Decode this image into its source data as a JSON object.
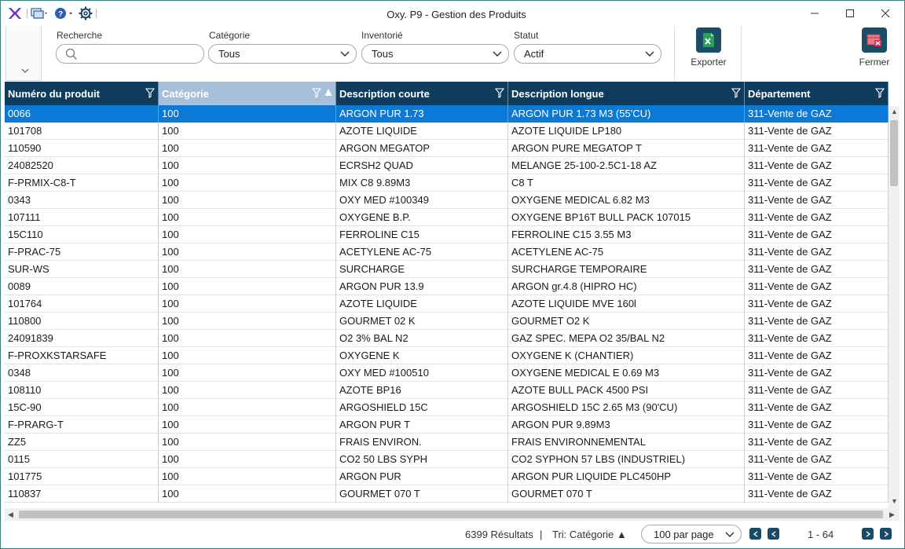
{
  "window": {
    "title": "Oxy. P9 - Gestion des Produits",
    "icons": [
      "app-logo-icon",
      "windows-icon",
      "help-icon",
      "settings-icon",
      "minimize-icon",
      "maximize-icon",
      "close-icon"
    ]
  },
  "filters": {
    "search": {
      "label": "Recherche",
      "value": "",
      "placeholder": ""
    },
    "category": {
      "label": "Catégorie",
      "value": "Tous"
    },
    "inventory": {
      "label": "Inventorié",
      "value": "Tous"
    },
    "status": {
      "label": "Statut",
      "value": "Actif"
    }
  },
  "actions": {
    "export_label": "Exporter",
    "close_label": "Fermer",
    "export_color": "#1a4d66",
    "close_color": "#1a4d66"
  },
  "grid": {
    "columns": [
      {
        "label": "Numéro du produit"
      },
      {
        "label": "Catégorie",
        "sorted": "asc"
      },
      {
        "label": "Description courte"
      },
      {
        "label": "Description longue"
      },
      {
        "label": "Département"
      }
    ],
    "selected_row": 0,
    "rows": [
      [
        "0066",
        "100",
        "ARGON PUR 1.73",
        "ARGON PUR 1.73 M3 (55'CU)",
        "311-Vente de GAZ"
      ],
      [
        "101708",
        "100",
        "AZOTE LIQUIDE",
        "AZOTE LIQUIDE  LP180",
        "311-Vente de GAZ"
      ],
      [
        "110590",
        "100",
        "ARGON MEGATOP",
        "ARGON PURE MEGATOP  T",
        "311-Vente de GAZ"
      ],
      [
        "24082520",
        "100",
        "ECRSH2 QUAD",
        "MELANGE 25-100-2.5C1-18 AZ",
        "311-Vente de GAZ"
      ],
      [
        "F-PRMIX-C8-T",
        "100",
        "MIX C8  9.89M3",
        "C8 T",
        "311-Vente de GAZ"
      ],
      [
        "0343",
        "100",
        "OXY MED #100349",
        "OXYGENE MEDICAL 6.82 M3",
        "311-Vente de GAZ"
      ],
      [
        "107111",
        "100",
        "OXYGENE B.P.",
        "OXYGENE BP16T  BULL PACK 107015",
        "311-Vente de GAZ"
      ],
      [
        "15C110",
        "100",
        "FERROLINE C15",
        "FERROLINE C15  3.55 M3",
        "311-Vente de GAZ"
      ],
      [
        "F-PRAC-75",
        "100",
        "ACETYLENE AC-75",
        "ACETYLENE AC-75",
        "311-Vente de GAZ"
      ],
      [
        "SUR-WS",
        "100",
        "SURCHARGE",
        "SURCHARGE TEMPORAIRE",
        "311-Vente de GAZ"
      ],
      [
        "0089",
        "100",
        "ARGON PUR 13.9",
        "ARGON gr.4.8 (HIPRO HC)",
        "311-Vente de GAZ"
      ],
      [
        "101764",
        "100",
        "AZOTE LIQUIDE",
        "AZOTE LIQUIDE MVE 160l",
        "311-Vente de GAZ"
      ],
      [
        "110800",
        "100",
        "GOURMET  02  K",
        "GOURMET O2  K",
        "311-Vente de GAZ"
      ],
      [
        "24091839",
        "100",
        "O2 3% BAL N2",
        "GAZ SPEC. MEPA O2 35/BAL N2",
        "311-Vente de GAZ"
      ],
      [
        "F-PROXKSTARSAFE",
        "100",
        "OXYGENE K",
        "OXYGENE K (CHANTIER)",
        "311-Vente de GAZ"
      ],
      [
        "0348",
        "100",
        "OXY MED #100510",
        "OXYGENE MEDICAL  E  0.69 M3",
        "311-Vente de GAZ"
      ],
      [
        "108110",
        "100",
        "AZOTE  BP16",
        "AZOTE  BULL PACK 4500 PSI",
        "311-Vente de GAZ"
      ],
      [
        "15C-90",
        "100",
        "ARGOSHIELD 15C",
        "ARGOSHIELD 15C 2.65 M3 (90'CU)",
        "311-Vente de GAZ"
      ],
      [
        "F-PRARG-T",
        "100",
        "ARGON PUR T",
        "ARGON PUR 9.89M3",
        "311-Vente de GAZ"
      ],
      [
        "ZZ5",
        "100",
        "FRAIS ENVIRON.",
        "FRAIS ENVIRONNEMENTAL",
        "311-Vente de GAZ"
      ],
      [
        "0115",
        "100",
        "CO2 50 LBS SYPH",
        "CO2 SYPHON 57 LBS (INDUSTRIEL)",
        "311-Vente de GAZ"
      ],
      [
        "101775",
        "100",
        "ARGON PUR",
        "ARGON PUR LIQUIDE  PLC450HP",
        "311-Vente de GAZ"
      ],
      [
        "110837",
        "100",
        "GOURMET 070 T",
        "GOURMET 070 T",
        "311-Vente de GAZ"
      ]
    ]
  },
  "status": {
    "results": "6399 Résultats",
    "separator": "|",
    "sort_label": "Tri: Catégorie ▲",
    "per_page": "100 par page",
    "range": "1 - 64"
  }
}
